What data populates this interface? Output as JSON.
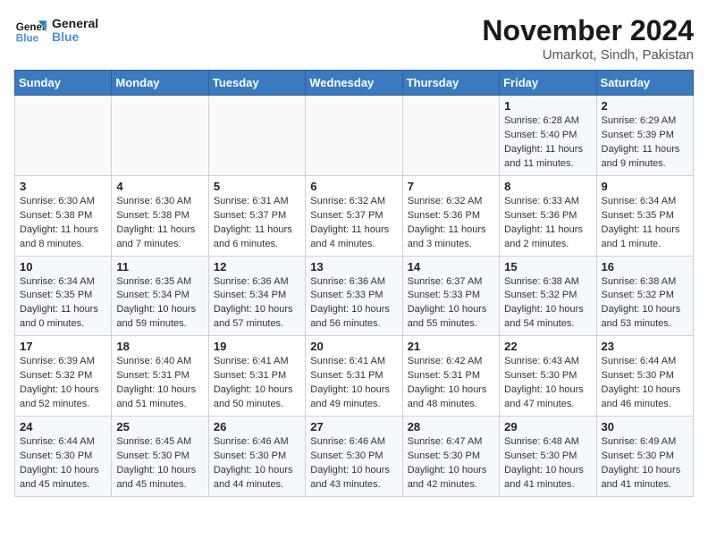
{
  "logo": {
    "line1": "General",
    "line2": "Blue"
  },
  "title": "November 2024",
  "location": "Umarkot, Sindh, Pakistan",
  "days_of_week": [
    "Sunday",
    "Monday",
    "Tuesday",
    "Wednesday",
    "Thursday",
    "Friday",
    "Saturday"
  ],
  "weeks": [
    [
      {
        "day": "",
        "info": ""
      },
      {
        "day": "",
        "info": ""
      },
      {
        "day": "",
        "info": ""
      },
      {
        "day": "",
        "info": ""
      },
      {
        "day": "",
        "info": ""
      },
      {
        "day": "1",
        "info": "Sunrise: 6:28 AM\nSunset: 5:40 PM\nDaylight: 11 hours and 11 minutes."
      },
      {
        "day": "2",
        "info": "Sunrise: 6:29 AM\nSunset: 5:39 PM\nDaylight: 11 hours and 9 minutes."
      }
    ],
    [
      {
        "day": "3",
        "info": "Sunrise: 6:30 AM\nSunset: 5:38 PM\nDaylight: 11 hours and 8 minutes."
      },
      {
        "day": "4",
        "info": "Sunrise: 6:30 AM\nSunset: 5:38 PM\nDaylight: 11 hours and 7 minutes."
      },
      {
        "day": "5",
        "info": "Sunrise: 6:31 AM\nSunset: 5:37 PM\nDaylight: 11 hours and 6 minutes."
      },
      {
        "day": "6",
        "info": "Sunrise: 6:32 AM\nSunset: 5:37 PM\nDaylight: 11 hours and 4 minutes."
      },
      {
        "day": "7",
        "info": "Sunrise: 6:32 AM\nSunset: 5:36 PM\nDaylight: 11 hours and 3 minutes."
      },
      {
        "day": "8",
        "info": "Sunrise: 6:33 AM\nSunset: 5:36 PM\nDaylight: 11 hours and 2 minutes."
      },
      {
        "day": "9",
        "info": "Sunrise: 6:34 AM\nSunset: 5:35 PM\nDaylight: 11 hours and 1 minute."
      }
    ],
    [
      {
        "day": "10",
        "info": "Sunrise: 6:34 AM\nSunset: 5:35 PM\nDaylight: 11 hours and 0 minutes."
      },
      {
        "day": "11",
        "info": "Sunrise: 6:35 AM\nSunset: 5:34 PM\nDaylight: 10 hours and 59 minutes."
      },
      {
        "day": "12",
        "info": "Sunrise: 6:36 AM\nSunset: 5:34 PM\nDaylight: 10 hours and 57 minutes."
      },
      {
        "day": "13",
        "info": "Sunrise: 6:36 AM\nSunset: 5:33 PM\nDaylight: 10 hours and 56 minutes."
      },
      {
        "day": "14",
        "info": "Sunrise: 6:37 AM\nSunset: 5:33 PM\nDaylight: 10 hours and 55 minutes."
      },
      {
        "day": "15",
        "info": "Sunrise: 6:38 AM\nSunset: 5:32 PM\nDaylight: 10 hours and 54 minutes."
      },
      {
        "day": "16",
        "info": "Sunrise: 6:38 AM\nSunset: 5:32 PM\nDaylight: 10 hours and 53 minutes."
      }
    ],
    [
      {
        "day": "17",
        "info": "Sunrise: 6:39 AM\nSunset: 5:32 PM\nDaylight: 10 hours and 52 minutes."
      },
      {
        "day": "18",
        "info": "Sunrise: 6:40 AM\nSunset: 5:31 PM\nDaylight: 10 hours and 51 minutes."
      },
      {
        "day": "19",
        "info": "Sunrise: 6:41 AM\nSunset: 5:31 PM\nDaylight: 10 hours and 50 minutes."
      },
      {
        "day": "20",
        "info": "Sunrise: 6:41 AM\nSunset: 5:31 PM\nDaylight: 10 hours and 49 minutes."
      },
      {
        "day": "21",
        "info": "Sunrise: 6:42 AM\nSunset: 5:31 PM\nDaylight: 10 hours and 48 minutes."
      },
      {
        "day": "22",
        "info": "Sunrise: 6:43 AM\nSunset: 5:30 PM\nDaylight: 10 hours and 47 minutes."
      },
      {
        "day": "23",
        "info": "Sunrise: 6:44 AM\nSunset: 5:30 PM\nDaylight: 10 hours and 46 minutes."
      }
    ],
    [
      {
        "day": "24",
        "info": "Sunrise: 6:44 AM\nSunset: 5:30 PM\nDaylight: 10 hours and 45 minutes."
      },
      {
        "day": "25",
        "info": "Sunrise: 6:45 AM\nSunset: 5:30 PM\nDaylight: 10 hours and 45 minutes."
      },
      {
        "day": "26",
        "info": "Sunrise: 6:46 AM\nSunset: 5:30 PM\nDaylight: 10 hours and 44 minutes."
      },
      {
        "day": "27",
        "info": "Sunrise: 6:46 AM\nSunset: 5:30 PM\nDaylight: 10 hours and 43 minutes."
      },
      {
        "day": "28",
        "info": "Sunrise: 6:47 AM\nSunset: 5:30 PM\nDaylight: 10 hours and 42 minutes."
      },
      {
        "day": "29",
        "info": "Sunrise: 6:48 AM\nSunset: 5:30 PM\nDaylight: 10 hours and 41 minutes."
      },
      {
        "day": "30",
        "info": "Sunrise: 6:49 AM\nSunset: 5:30 PM\nDaylight: 10 hours and 41 minutes."
      }
    ]
  ]
}
